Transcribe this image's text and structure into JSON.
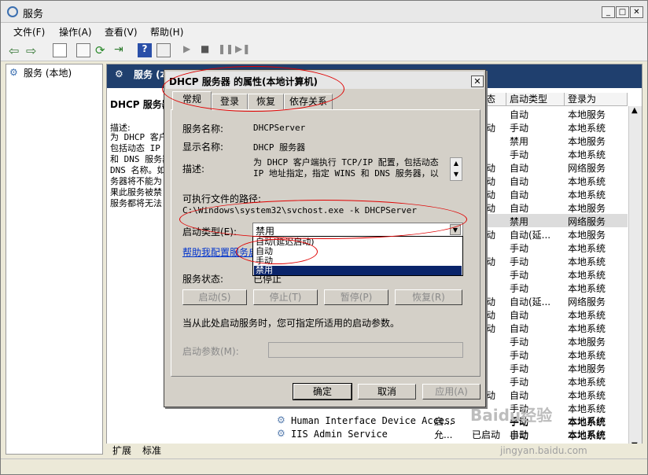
{
  "window": {
    "title": "服务"
  },
  "menu": [
    "文件(F)",
    "操作(A)",
    "查看(V)",
    "帮助(H)"
  ],
  "tree": {
    "root": "服务 (本地)"
  },
  "right_header": "服务 (本地)",
  "left_desc": {
    "title": "DHCP 服务器",
    "desc_label": "描述:",
    "desc_lines": [
      "为 DHCP 客户",
      "包括动态 IP",
      "和 DNS 服务器",
      "DNS 名称。如",
      "务器将不能为",
      "果此服务被禁",
      "服务都将无法"
    ]
  },
  "columns": {
    "status": "态",
    "startup_type": "启动类型",
    "logon_as": "登录为"
  },
  "rows": [
    [
      "",
      "自动",
      "本地服务"
    ],
    [
      "动",
      "手动",
      "本地系统"
    ],
    [
      "",
      "禁用",
      "本地服务"
    ],
    [
      "",
      "手动",
      "本地系统"
    ],
    [
      "动",
      "自动",
      "网络服务"
    ],
    [
      "动",
      "自动",
      "本地系统"
    ],
    [
      "动",
      "自动",
      "本地系统"
    ],
    [
      "动",
      "自动",
      "本地服务"
    ],
    [
      "",
      "禁用",
      "网络服务"
    ],
    [
      "动",
      "自动(延...",
      "本地服务"
    ],
    [
      "",
      "手动",
      "本地系统"
    ],
    [
      "动",
      "手动",
      "本地系统"
    ],
    [
      "",
      "手动",
      "本地系统"
    ],
    [
      "",
      "手动",
      "本地系统"
    ],
    [
      "动",
      "自动(延...",
      "网络服务"
    ],
    [
      "动",
      "自动",
      "本地系统"
    ],
    [
      "动",
      "自动",
      "本地系统"
    ],
    [
      "",
      "手动",
      "本地服务"
    ],
    [
      "",
      "手动",
      "本地系统"
    ],
    [
      "",
      "手动",
      "本地服务"
    ],
    [
      "",
      "手动",
      "本地系统"
    ],
    [
      "动",
      "自动",
      "本地系统"
    ],
    [
      "",
      "手动",
      "本地系统"
    ],
    [
      "",
      "手动",
      "本地系统"
    ],
    [
      "",
      "手动",
      "本地系统"
    ]
  ],
  "bottom_rows": [
    {
      "name": "Human Interface Device Access",
      "desc": "启...",
      "status": "",
      "startup": "手动",
      "logon": "本地系统"
    },
    {
      "name": "IIS Admin Service",
      "desc": "允...",
      "status": "已启动",
      "startup": "自动",
      "logon": "本地系统"
    }
  ],
  "bottom_tabs": [
    "扩展",
    "标准"
  ],
  "dialog": {
    "title": "DHCP 服务器 的属性(本地计算机)",
    "tabs": [
      "常规",
      "登录",
      "恢复",
      "依存关系"
    ],
    "service_name_label": "服务名称:",
    "service_name": "DHCPServer",
    "display_name_label": "显示名称:",
    "display_name": "DHCP 服务器",
    "desc_label": "描述:",
    "desc_line1": "为 DHCP 客户端执行 TCP/IP 配置，包括动态",
    "desc_line2": "IP 地址指定，指定 WINS 和 DNS 服务器，以",
    "path_label": "可执行文件的路径:",
    "path": "C:\\Windows\\system32\\svchost.exe -k DHCPServer",
    "startup_label": "启动类型(E):",
    "startup_value": "禁用",
    "startup_options": [
      "自动(延迟启动)",
      "自动",
      "手动",
      "禁用"
    ],
    "help_link": "帮助我配置服务启",
    "status_label": "服务状态:",
    "status_value": "已停止",
    "buttons": {
      "start": "启动(S)",
      "stop": "停止(T)",
      "pause": "暂停(P)",
      "resume": "恢复(R)"
    },
    "hint": "当从此处启动服务时，您可指定所适用的启动参数。",
    "params_label": "启动参数(M):",
    "ok": "确定",
    "cancel": "取消",
    "apply": "应用(A)"
  },
  "watermark": {
    "main": "Baidu经验",
    "sub": "jingyan.baidu.com"
  }
}
